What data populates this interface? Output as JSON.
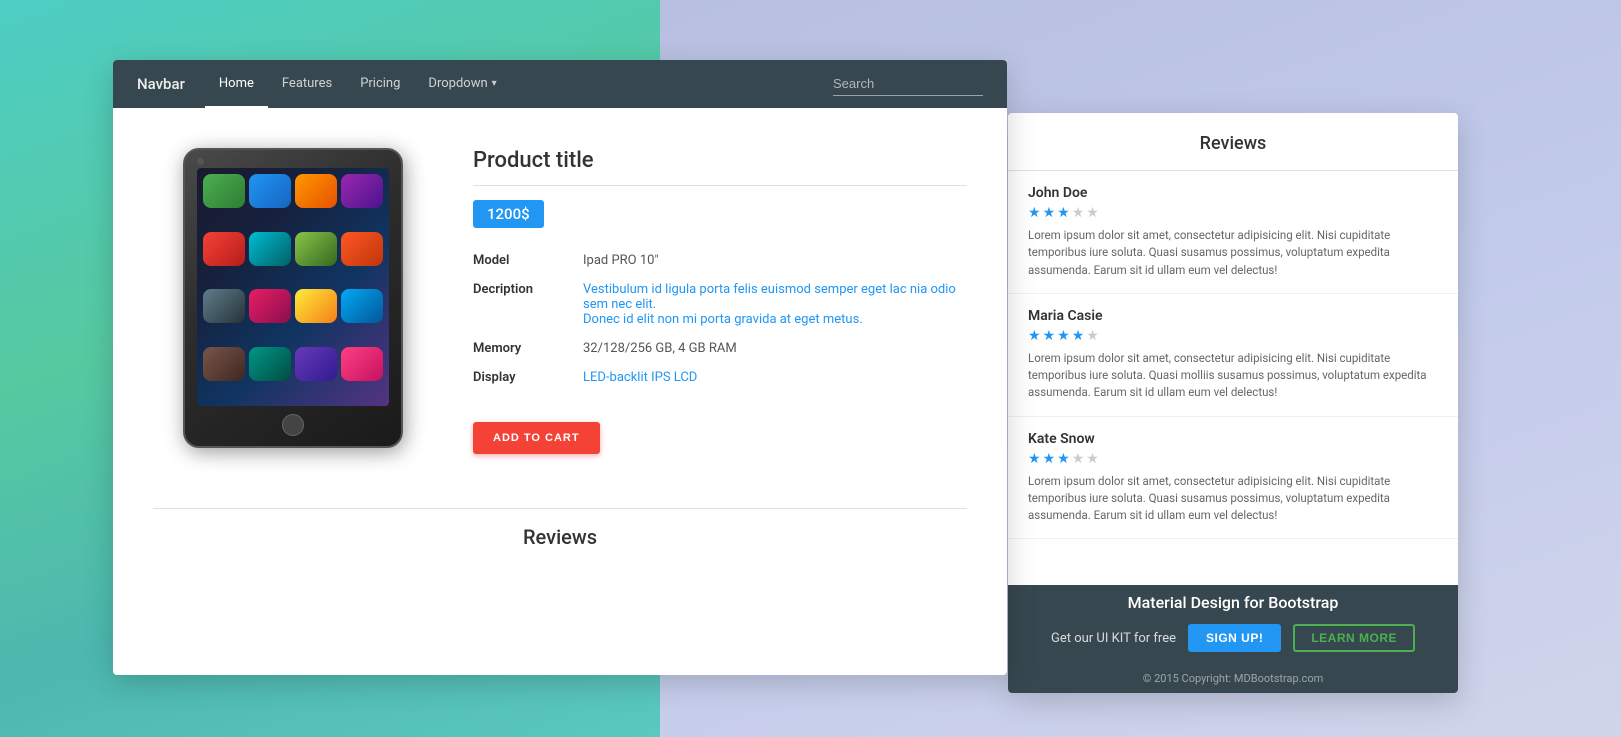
{
  "background": {
    "left_color": "#4ecdc4",
    "right_color": "#c2caec"
  },
  "navbar": {
    "brand": "Navbar",
    "links": [
      {
        "label": "Home",
        "active": true
      },
      {
        "label": "Features",
        "active": false
      },
      {
        "label": "Pricing",
        "active": false
      },
      {
        "label": "Dropdown",
        "active": false,
        "has_dropdown": true
      }
    ],
    "search_placeholder": "Search"
  },
  "product": {
    "title": "Product title",
    "price": "1200$",
    "specs": [
      {
        "label": "Model",
        "value": "Ipad PRO 10\""
      },
      {
        "label": "Decription",
        "value_part1": "Vestibulum id ligula porta felis euismod semper eget lac nia odio sem nec elit.",
        "value_part2": "Donec id elit non mi porta gravida at eget metus."
      },
      {
        "label": "Memory",
        "value": "32/128/256 GB, 4 GB RAM"
      },
      {
        "label": "Display",
        "value": "LED-backlit IPS LCD"
      }
    ],
    "add_to_cart_label": "ADD TO CART"
  },
  "reviews_section": {
    "title": "Reviews"
  },
  "reviews_panel": {
    "title": "Reviews",
    "reviews": [
      {
        "name": "John Doe",
        "stars": 3,
        "text": "Lorem ipsum dolor sit amet, consectetur adipisicing elit. Nisi cupiditate temporibus iure soluta. Quasi susamus possimus, voluptatum expedita assumenda. Earum sit id ullam eum vel delectus!"
      },
      {
        "name": "Maria Casie",
        "stars": 4,
        "text": "Lorem ipsum dolor sit amet, consectetur adipisicing elit. Nisi cupiditate temporibus iure soluta. Quasi molliis susamus possimus, voluptatum expedita assumenda. Earum sit id ullam eum vel delectus!"
      },
      {
        "name": "Kate Snow",
        "stars": 3,
        "text": "Lorem ipsum dolor sit amet, consectetur adipisicing elit. Nisi cupiditate temporibus iure soluta. Quasi susamus possimus, voluptatum expedita assumenda. Earum sit id ullam eum vel delectus!"
      }
    ]
  },
  "footer_cta": {
    "title": "Material Design for Bootstrap",
    "get_kit_text": "Get our UI KIT for free",
    "signup_label": "SIGN UP!",
    "learn_more_label": "LEARN MORE",
    "copyright": "© 2015 Copyright: MDBootstrap.com"
  }
}
